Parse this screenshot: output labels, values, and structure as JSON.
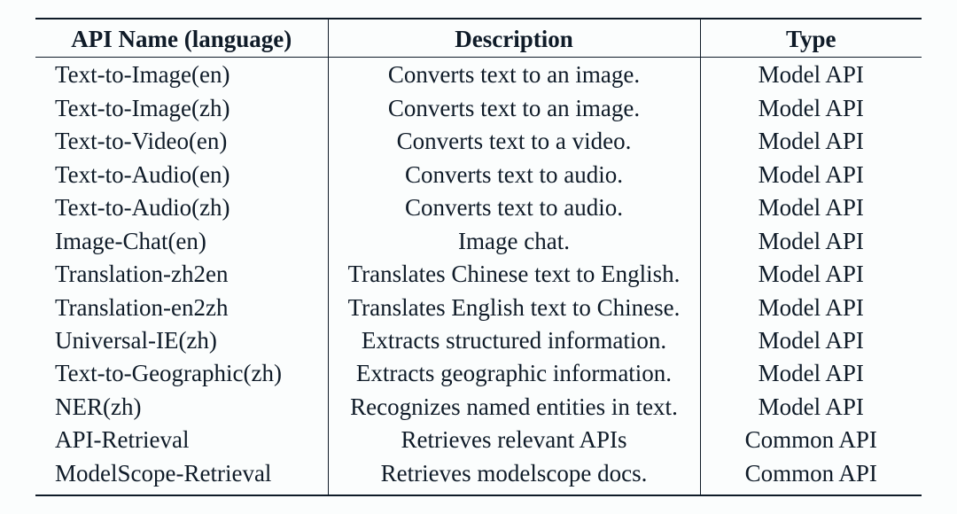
{
  "table": {
    "headers": {
      "name": "API Name (language)",
      "description": "Description",
      "type": "Type"
    },
    "rows": [
      {
        "name": "Text-to-Image(en)",
        "description": "Converts text to an image.",
        "type": "Model API"
      },
      {
        "name": "Text-to-Image(zh)",
        "description": "Converts text to an image.",
        "type": "Model API"
      },
      {
        "name": "Text-to-Video(en)",
        "description": "Converts text to a video.",
        "type": "Model API"
      },
      {
        "name": "Text-to-Audio(en)",
        "description": "Converts text to audio.",
        "type": "Model API"
      },
      {
        "name": "Text-to-Audio(zh)",
        "description": "Converts text to audio.",
        "type": "Model API"
      },
      {
        "name": "Image-Chat(en)",
        "description": "Image chat.",
        "type": "Model API"
      },
      {
        "name": "Translation-zh2en",
        "description": "Translates Chinese text to English.",
        "type": "Model API"
      },
      {
        "name": "Translation-en2zh",
        "description": "Translates English text to Chinese.",
        "type": "Model API"
      },
      {
        "name": "Universal-IE(zh)",
        "description": "Extracts structured information.",
        "type": "Model API"
      },
      {
        "name": "Text-to-Geographic(zh)",
        "description": "Extracts geographic information.",
        "type": "Model API"
      },
      {
        "name": "NER(zh)",
        "description": "Recognizes named entities in text.",
        "type": "Model API"
      },
      {
        "name": "API-Retrieval",
        "description": "Retrieves relevant APIs",
        "type": "Common API"
      },
      {
        "name": "ModelScope-Retrieval",
        "description": "Retrieves modelscope docs.",
        "type": "Common API"
      }
    ]
  }
}
